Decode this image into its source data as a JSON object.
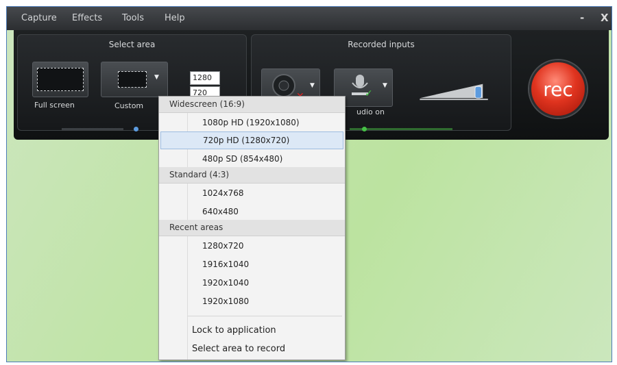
{
  "menubar": {
    "items": [
      {
        "label": "Capture"
      },
      {
        "label": "Effects"
      },
      {
        "label": "Tools"
      },
      {
        "label": "Help"
      }
    ],
    "minimize": "-",
    "close": "X"
  },
  "select_area": {
    "title": "Select area",
    "full_screen": "Full screen",
    "custom": "Custom",
    "width": "1280",
    "height": "720"
  },
  "recorded_inputs": {
    "title": "Recorded inputs",
    "audio_label": "udio on"
  },
  "rec_button": "rec",
  "context_menu": {
    "sections": [
      {
        "header": "Widescreen (16:9)",
        "items": [
          "1080p HD (1920x1080)",
          "720p HD (1280x720)",
          "480p SD (854x480)"
        ]
      },
      {
        "header": "Standard (4:3)",
        "items": [
          "1024x768",
          "640x480"
        ]
      },
      {
        "header": "Recent areas",
        "items": [
          "1280x720",
          "1916x1040",
          "1920x1040",
          "1920x1080"
        ]
      }
    ],
    "highlighted": "720p HD (1280x720)",
    "actions": [
      "Lock to application",
      "Select area to record"
    ]
  },
  "colors": {
    "rec": "#e0341f",
    "highlight": "#dce8f6",
    "accent": "#5c9bde",
    "check": "#3fbf3f",
    "cross": "#e02020"
  }
}
